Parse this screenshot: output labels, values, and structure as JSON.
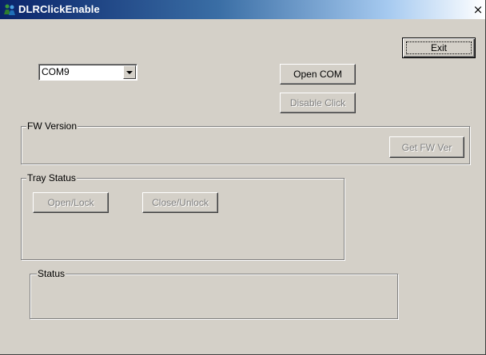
{
  "window": {
    "title": "DLRClickEnable",
    "close_glyph": "×"
  },
  "buttons": {
    "exit": "Exit",
    "open_com": "Open COM",
    "disable_click": "Disable Click",
    "get_fw_ver": "Get FW Ver",
    "open_lock": "Open/Lock",
    "close_unlock": "Close/Unlock"
  },
  "combo": {
    "value": "COM9"
  },
  "groups": {
    "fw_version": "FW Version",
    "tray_status": "Tray Status",
    "status": "Status"
  },
  "icons": {
    "app": "app-people-icon",
    "close": "close-icon",
    "dropdown": "chevron-down-icon"
  }
}
